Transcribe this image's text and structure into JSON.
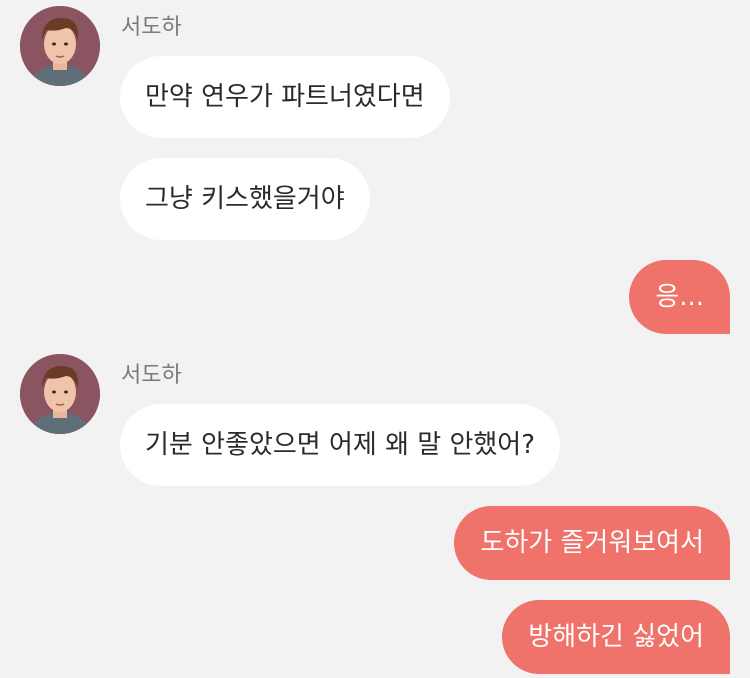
{
  "theme": {
    "background": "#f2f2f2",
    "incoming_bubble": "#ffffff",
    "outgoing_bubble": "#ef726b",
    "sender_name_color": "#7a7a7a"
  },
  "messages": [
    {
      "sender": "서도하",
      "direction": "incoming",
      "avatar_icon": "user-avatar-icon",
      "text": "만약 연우가 파트너였다면"
    },
    {
      "direction": "incoming",
      "text": "그냥 키스했을거야"
    },
    {
      "direction": "outgoing",
      "text": "응..."
    },
    {
      "sender": "서도하",
      "direction": "incoming",
      "avatar_icon": "user-avatar-icon",
      "text": "기분 안좋았으면 어제 왜 말 안했어?"
    },
    {
      "direction": "outgoing",
      "text": "도하가 즐거워보여서"
    },
    {
      "direction": "outgoing",
      "text": "방해하긴 싫었어"
    }
  ]
}
